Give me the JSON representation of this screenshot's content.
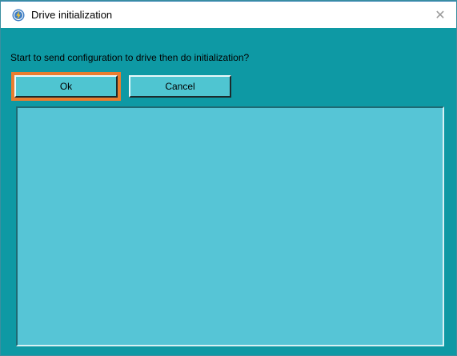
{
  "window": {
    "title": "Drive initialization",
    "close_symbol": "✕"
  },
  "dialog": {
    "message": "Start to send configuration to drive then do initialization?",
    "ok_label": "Ok",
    "cancel_label": "Cancel",
    "log_text": ""
  },
  "colors": {
    "client_background": "#0e99a4",
    "button_face": "#4fc5d1",
    "log_background": "#56c5d6",
    "focus_highlight": "#ea7d2f"
  },
  "icons": {
    "app": "app-logo-icon",
    "close": "close-icon"
  }
}
